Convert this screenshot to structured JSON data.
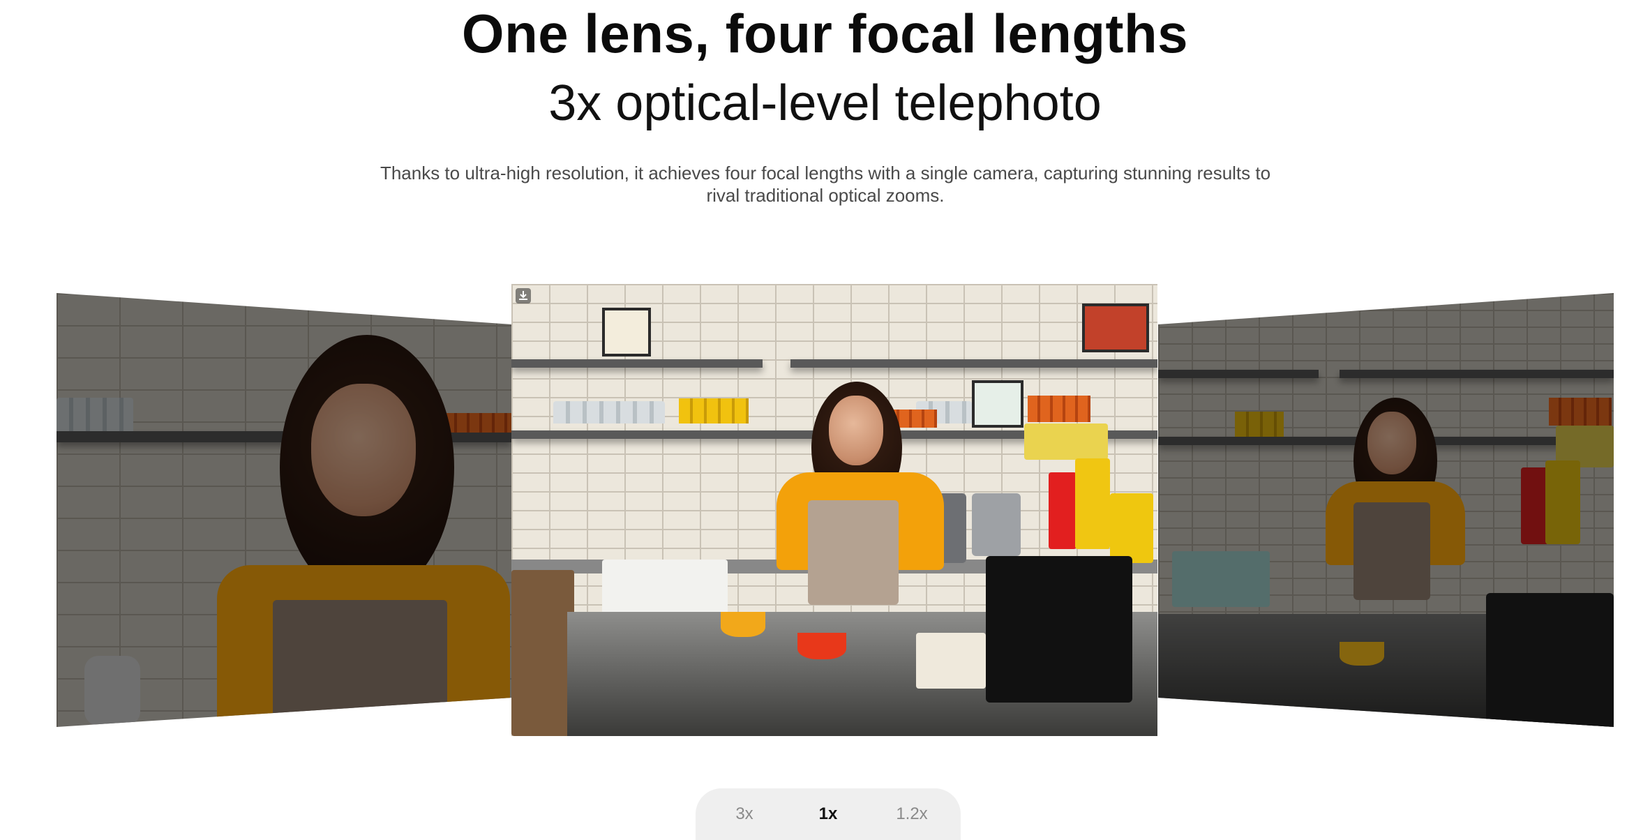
{
  "header": {
    "headline": "One lens, four focal lengths",
    "subheadline": "3x optical-level telephoto",
    "description": "Thanks to ultra-high resolution, it achieves four focal lengths with a single camera, capturing stunning results to rival traditional optical zooms."
  },
  "carousel": {
    "panels": [
      {
        "position": "left",
        "state": "dimmed"
      },
      {
        "position": "center",
        "state": "active"
      },
      {
        "position": "right",
        "state": "dimmed"
      }
    ],
    "download_icon": "download-icon"
  },
  "zoom_selector": {
    "options": [
      {
        "label": "3x"
      },
      {
        "label": "1x"
      },
      {
        "label": "1.2x"
      }
    ],
    "selected": "1x"
  },
  "colors": {
    "accent_yellow": "#f3a10a",
    "selector_bg": "#efefef",
    "text_dark": "#0b0b0b",
    "text_muted": "#4a4a4a"
  }
}
